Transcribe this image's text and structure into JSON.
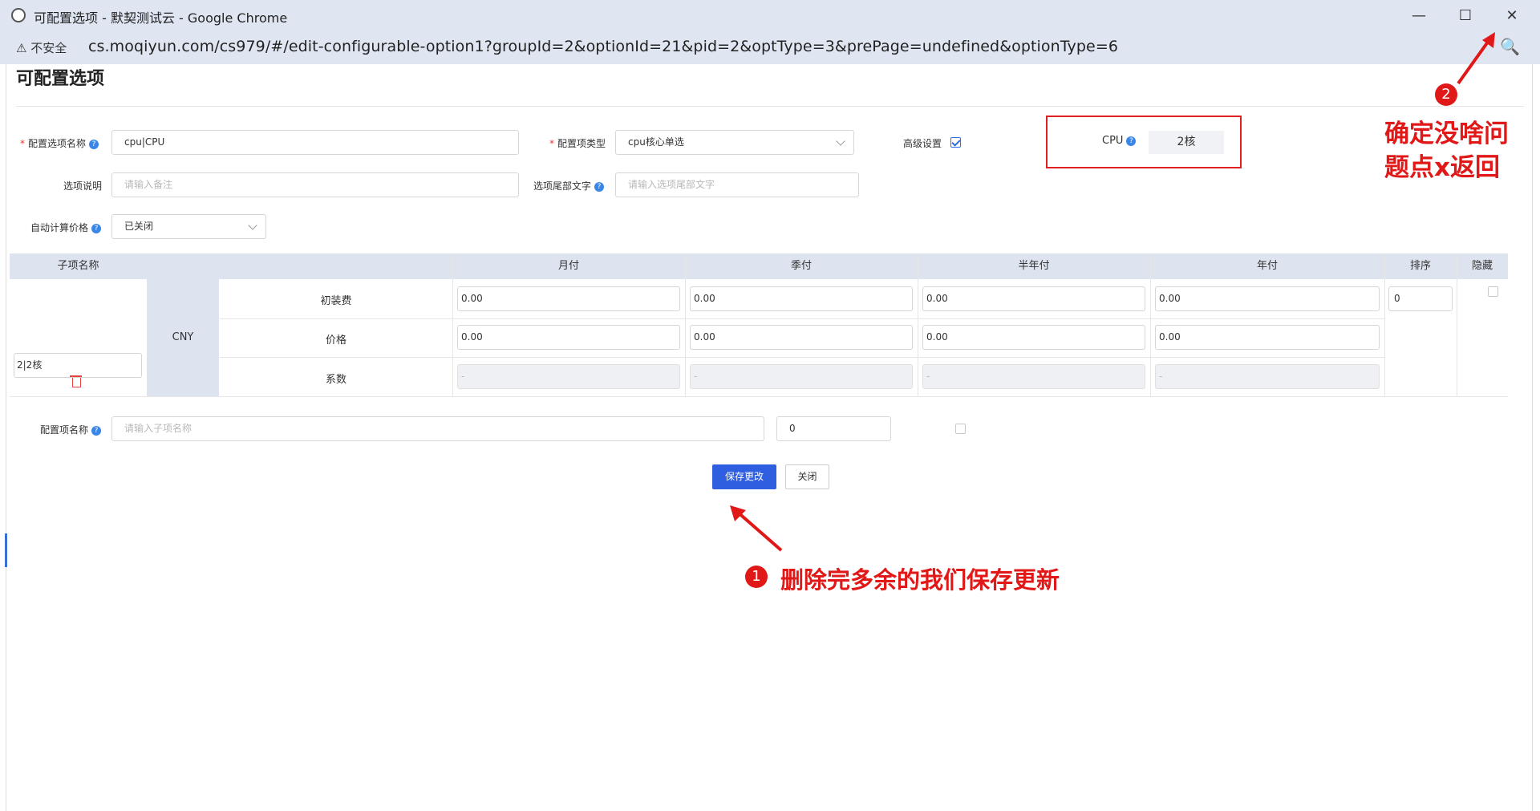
{
  "window": {
    "title": "可配置选项 - 默契测试云 - Google Chrome",
    "minimize": "—",
    "maximize": "☐",
    "close": "✕"
  },
  "address": {
    "security": "⚠ 不安全",
    "url": "cs.moqiyun.com/cs979/#/edit-configurable-option1?groupId=2&optionId=21&pid=2&optType=3&prePage=undefined&optionType=6",
    "zoom_icon": "🔍"
  },
  "page": {
    "title": "可配置选项"
  },
  "form": {
    "option_name_label": "配置选项名称",
    "option_name_value": "cpu|CPU",
    "option_type_label": "配置项类型",
    "option_type_value": "cpu核心单选",
    "advanced_label": "高级设置",
    "advanced_checked": true,
    "desc_label": "选项说明",
    "desc_placeholder": "请输入备注",
    "suffix_label": "选项尾部文字",
    "suffix_placeholder": "请输入选项尾部文字",
    "auto_price_label": "自动计算价格",
    "auto_price_value": "已关闭"
  },
  "preview": {
    "label": "CPU",
    "value": "2核"
  },
  "table": {
    "headers": [
      "子项名称",
      "月付",
      "季付",
      "半年付",
      "年付",
      "排序",
      "隐藏"
    ],
    "currency": "CNY",
    "row_labels": [
      "初装费",
      "价格",
      "系数"
    ],
    "sub_item_name": "2|2核",
    "setup_fees": [
      "0.00",
      "0.00",
      "0.00",
      "0.00"
    ],
    "prices": [
      "0.00",
      "0.00",
      "0.00",
      "0.00"
    ],
    "coefficients": [
      "-",
      "-",
      "-",
      "-"
    ],
    "sort": "0"
  },
  "new_item": {
    "label": "配置项名称",
    "placeholder": "请输入子项名称",
    "sort_value": "0"
  },
  "buttons": {
    "save": "保存更改",
    "close": "关闭"
  },
  "annotations": {
    "note1_num": "1",
    "note1_text": "删除完多余的我们保存更新",
    "note2_num": "2",
    "note2_line1": "确定没啥问",
    "note2_line2": "题点x返回"
  }
}
